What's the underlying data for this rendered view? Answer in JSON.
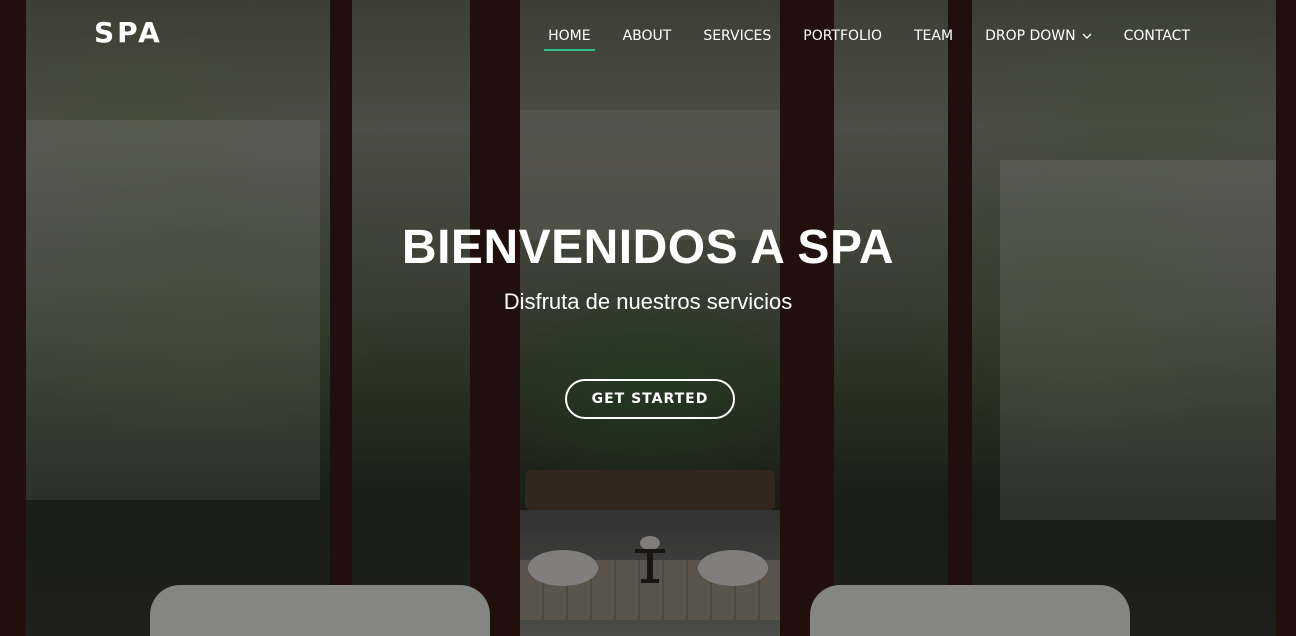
{
  "header": {
    "logo": "SPA",
    "nav": [
      {
        "label": "HOME",
        "active": true
      },
      {
        "label": "ABOUT"
      },
      {
        "label": "SERVICES"
      },
      {
        "label": "PORTFOLIO"
      },
      {
        "label": "TEAM"
      },
      {
        "label": "DROP DOWN",
        "icon": "chevron-down-icon"
      },
      {
        "label": "CONTACT"
      }
    ]
  },
  "hero": {
    "title": "BIENVENIDOS A SPA",
    "subtitle": "Disfruta de nuestros servicios",
    "cta_label": "GET STARTED"
  },
  "colors": {
    "accent": "#2ec18f",
    "text": "#ffffff"
  }
}
